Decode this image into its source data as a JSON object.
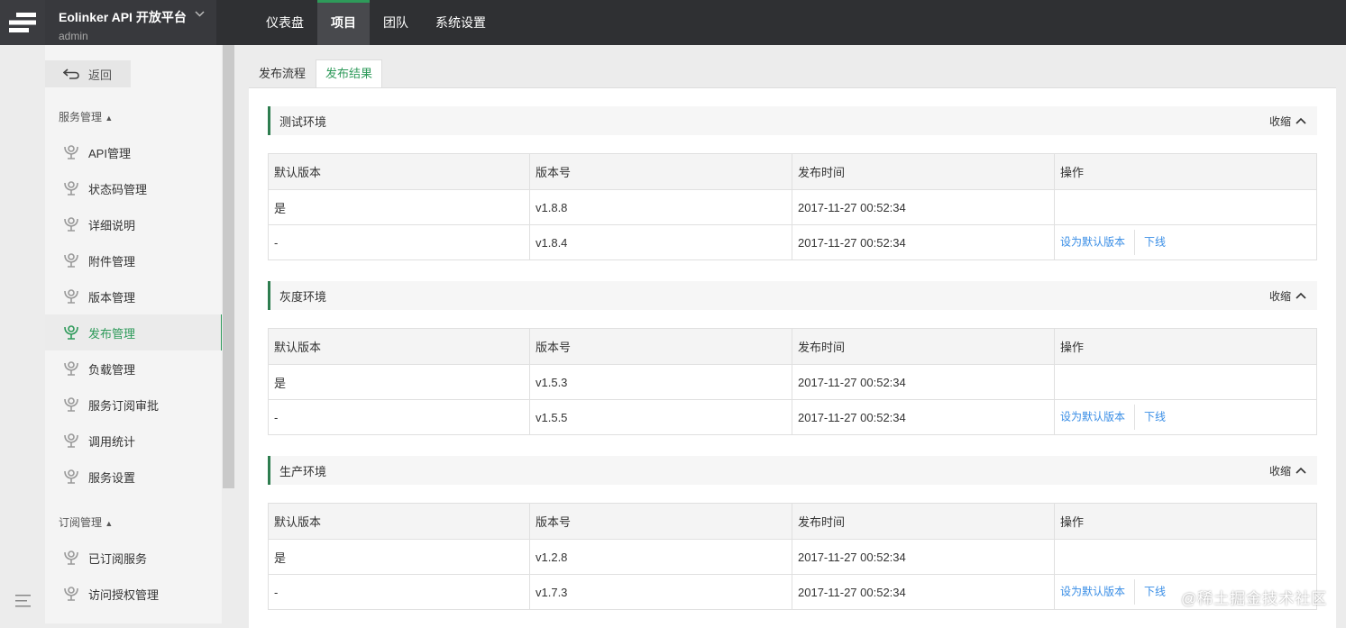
{
  "topbar": {
    "brand_title": "Eolinker API 开放平台",
    "brand_user": "admin",
    "nav": [
      {
        "label": "仪表盘"
      },
      {
        "label": "项目"
      },
      {
        "label": "团队"
      },
      {
        "label": "系统设置"
      }
    ]
  },
  "sidebar": {
    "back_label": "返回",
    "group1_title": "服务管理",
    "group1_items": [
      "API管理",
      "状态码管理",
      "详细说明",
      "附件管理",
      "版本管理",
      "发布管理",
      "负载管理",
      "服务订阅审批",
      "调用统计",
      "服务设置"
    ],
    "group2_title": "订阅管理",
    "group2_items": [
      "已订阅服务",
      "访问授权管理"
    ]
  },
  "tabs": [
    "发布流程",
    "发布结果"
  ],
  "collapse_label": "收缩",
  "table_headers": [
    "默认版本",
    "版本号",
    "发布时间",
    "操作"
  ],
  "environments": [
    {
      "title": "测试环境",
      "rows": [
        {
          "default": "是",
          "version": "v1.8.8",
          "time": "2017-11-27 00:52:34"
        },
        {
          "default": "-",
          "version": "v1.8.4",
          "time": "2017-11-27 00:52:34",
          "op_set": "设为默认版本",
          "op_off": "下线"
        }
      ]
    },
    {
      "title": "灰度环境",
      "rows": [
        {
          "default": "是",
          "version": "v1.5.3",
          "time": "2017-11-27 00:52:34"
        },
        {
          "default": "-",
          "version": "v1.5.5",
          "time": "2017-11-27 00:52:34",
          "op_set": "设为默认版本",
          "op_off": "下线"
        }
      ]
    },
    {
      "title": "生产环境",
      "rows": [
        {
          "default": "是",
          "version": "v1.2.8",
          "time": "2017-11-27 00:52:34"
        },
        {
          "default": "-",
          "version": "v1.7.3",
          "time": "2017-11-27 00:52:34",
          "op_set": "设为默认版本",
          "op_off": "下线"
        }
      ]
    }
  ],
  "watermark": "@稀土掘金技术社区",
  "colors": {
    "accent": "#2e9a5a",
    "link": "#3a8ee6",
    "topbar": "#2f3033"
  }
}
